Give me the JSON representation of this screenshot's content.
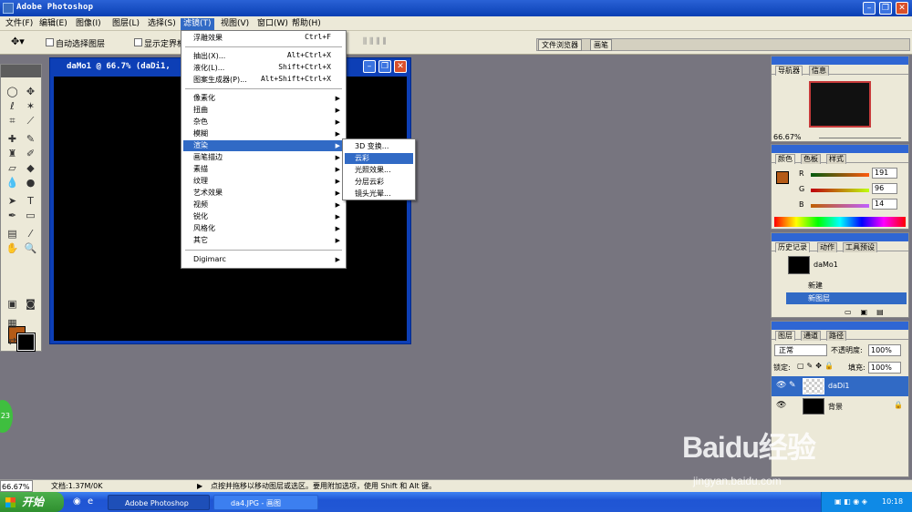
{
  "window": {
    "title": "Adobe Photoshop"
  },
  "menubar": {
    "items": [
      "文件(F)",
      "编辑(E)",
      "图像(I)",
      "图层(L)",
      "选择(S)",
      "滤镜(T)",
      "视图(V)",
      "窗口(W)",
      "帮助(H)"
    ],
    "active": "滤镜(T)"
  },
  "options": {
    "auto_select": "自动选择图层",
    "show_bounds": "显示定界框",
    "file_browser_tab": "文件浏览器",
    "brushes_tab": "画笔"
  },
  "document": {
    "title": "daMo1 @ 66.7% (daDi1,"
  },
  "filter_menu": {
    "items": [
      {
        "label": "浮雕效果",
        "shortcut": "Ctrl+F"
      },
      {
        "label": "抽出(X)...",
        "shortcut": "Alt+Ctrl+X"
      },
      {
        "label": "液化(L)...",
        "shortcut": "Shift+Ctrl+X"
      },
      {
        "label": "图案生成器(P)...",
        "shortcut": "Alt+Shift+Ctrl+X"
      },
      {
        "label": "像素化"
      },
      {
        "label": "扭曲"
      },
      {
        "label": "杂色"
      },
      {
        "label": "模糊"
      },
      {
        "label": "渲染"
      },
      {
        "label": "画笔描边"
      },
      {
        "label": "素描"
      },
      {
        "label": "纹理"
      },
      {
        "label": "艺术效果"
      },
      {
        "label": "视频"
      },
      {
        "label": "锐化"
      },
      {
        "label": "风格化"
      },
      {
        "label": "其它"
      },
      {
        "label": "Digimarc"
      }
    ],
    "highlighted": "渲染"
  },
  "render_submenu": {
    "items": [
      "3D 变换...",
      "云彩",
      "光照效果...",
      "分层云彩",
      "镜头光晕..."
    ],
    "highlighted": "云彩"
  },
  "navigator": {
    "tabs": [
      "导航器",
      "信息"
    ],
    "zoom": "66.67%"
  },
  "color": {
    "tabs": [
      "颜色",
      "色板",
      "样式"
    ],
    "r": "191",
    "g": "96",
    "b": "14",
    "labels": [
      "R",
      "G",
      "B"
    ],
    "fg_hex": "#b45a16"
  },
  "history": {
    "tabs": [
      "历史记录",
      "动作",
      "工具预设"
    ],
    "snapshot": "daMo1",
    "steps": [
      "新建",
      "新图层"
    ]
  },
  "layers": {
    "tabs": [
      "图层",
      "通道",
      "路径"
    ],
    "blend_mode": "正常",
    "opacity_label": "不透明度:",
    "opacity": "100%",
    "lock_label": "锁定:",
    "fill_label": "填充:",
    "fill": "100%",
    "items": [
      "daDi1",
      "背景"
    ]
  },
  "status": {
    "zoom": "66.67%",
    "doc": "文档:1.37M/0K",
    "hint": "点按并拖移以移动图层或选区。要用附加选项，使用 Shift 和 Alt 键。"
  },
  "taskbar": {
    "start": "开始",
    "tasks": [
      "Adobe Photoshop",
      "da4.JPG - 画图"
    ],
    "clock": "10:18"
  },
  "badge": "23",
  "watermark": {
    "brand": "Baidu经验",
    "url": "jingyan.baidu.com"
  }
}
